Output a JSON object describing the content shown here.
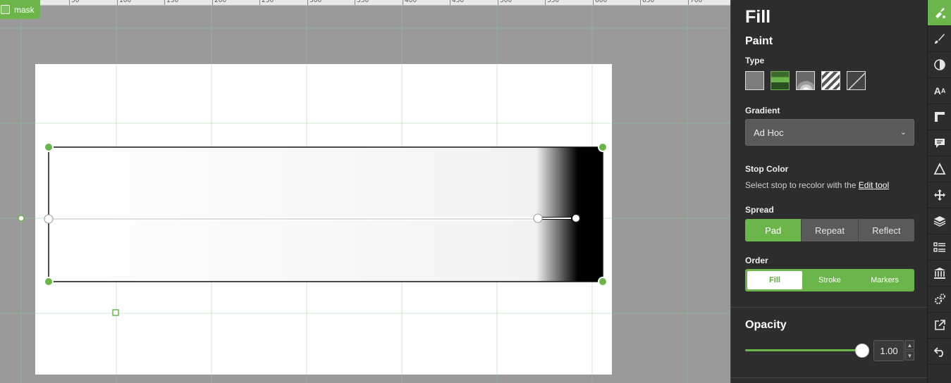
{
  "canvas": {
    "layer_chip": "mask",
    "ruler_ticks": [
      "50",
      "100",
      "150",
      "200",
      "250",
      "300",
      "350",
      "400",
      "450",
      "500",
      "550",
      "600",
      "650",
      "700"
    ]
  },
  "panel": {
    "title": "Fill",
    "paint_title": "Paint",
    "type_label": "Type",
    "gradient_label": "Gradient",
    "gradient_value": "Ad Hoc",
    "stop_color_label": "Stop Color",
    "stop_hint_prefix": "Select stop to recolor with the",
    "stop_hint_link": "Edit tool",
    "spread_label": "Spread",
    "spread_options": [
      "Pad",
      "Repeat",
      "Reflect"
    ],
    "spread_selected": "Pad",
    "order_label": "Order",
    "order_options": [
      "Fill",
      "Stroke",
      "Markers"
    ],
    "order_selected": "Fill",
    "opacity_title": "Opacity",
    "opacity_value": "1.00",
    "opacity_level": 1.0
  },
  "sidebar_icons": [
    "paint-bucket-icon",
    "brush-icon",
    "contrast-icon",
    "typography-icon",
    "ruler-icon",
    "comment-icon",
    "triangle-icon",
    "move-icon",
    "layers-icon",
    "list-icon",
    "library-icon",
    "settings-icon",
    "export-icon",
    "undo-icon"
  ],
  "colors": {
    "accent": "#6bb54a",
    "panel_bg": "#2d2d2d",
    "canvas_bg": "#9a9a9a"
  }
}
